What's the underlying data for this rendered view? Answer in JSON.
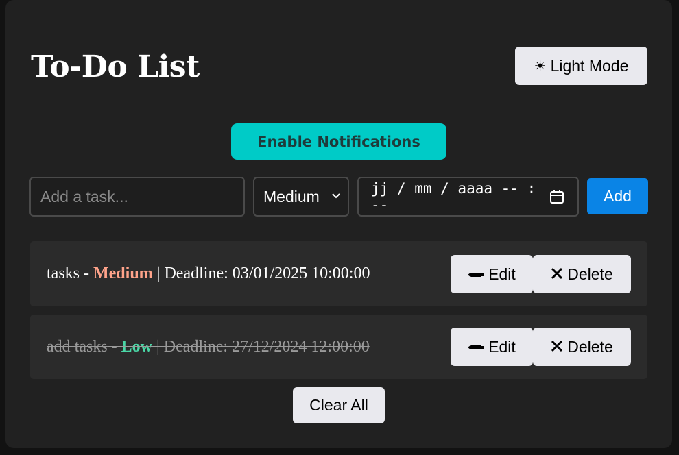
{
  "header": {
    "title": "To-Do List",
    "theme_toggle": {
      "icon": "sun-icon",
      "icon_glyph": "☀",
      "label": "Light Mode"
    }
  },
  "notifications": {
    "label": "Enable Notifications"
  },
  "form": {
    "task_placeholder": "Add a task...",
    "task_value": "",
    "priority_selected": "Medium",
    "datetime_placeholder": "jj / mm / aaaa   -- : --",
    "add_label": "Add"
  },
  "tasks": [
    {
      "name": "tasks",
      "separator": " - ",
      "priority": "Medium",
      "deadline_text": " | Deadline: 03/01/2025 10:00:00",
      "completed": false,
      "edit_icon": "pen-icon",
      "edit_glyph": "✏",
      "edit_label": "Edit",
      "delete_icon": "x-icon",
      "delete_glyph": "✕",
      "delete_label": "Delete"
    },
    {
      "name": "add tasks",
      "separator": " - ",
      "priority": "Low",
      "deadline_text": " | Deadline: 27/12/2024 12:00:00",
      "completed": true,
      "edit_icon": "pen-icon",
      "edit_glyph": "✏",
      "edit_label": "Edit",
      "delete_icon": "x-icon",
      "delete_glyph": "✕",
      "delete_label": "Delete"
    }
  ],
  "clear_all_label": "Clear All",
  "colors": {
    "accent_notify": "#00cbc7",
    "add_button": "#0a84e6",
    "priority_medium": "#ffa38a",
    "priority_low": "#4ad7a6"
  }
}
